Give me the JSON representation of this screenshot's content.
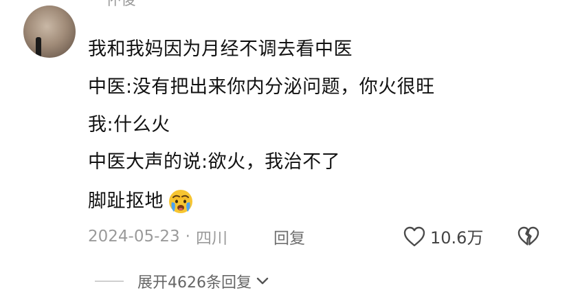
{
  "comment": {
    "username": "怀俊",
    "lines": [
      "我和我妈因为月经不调去看中医",
      "中医:没有把出来你内分泌问题，你火很旺",
      "我:什么火",
      "中医大声的说:欲火，我治不了",
      "脚趾抠地"
    ],
    "emoji_icon": "crying-face-emoji",
    "date": "2024-05-23",
    "separator": "·",
    "location": "四川",
    "reply_label": "回复",
    "like_count": "10.6万",
    "like_icon": "heart-outline-icon",
    "dislike_icon": "broken-heart-icon",
    "expand_label": "展开4626条回复",
    "expand_icon": "chevron-down-icon"
  }
}
